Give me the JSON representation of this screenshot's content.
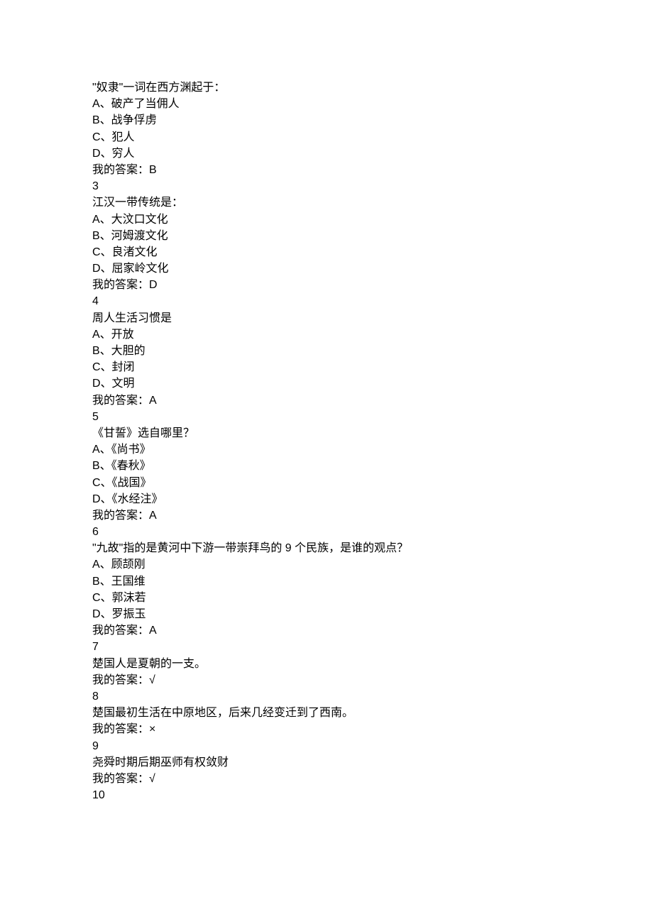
{
  "answer_prefix": "我的答案：",
  "tick": "√",
  "cross": "×",
  "items": [
    {
      "lines": [
        "\"奴隶\"一词在西方渊起于：",
        "A、破产了当佣人",
        "B、战争俘虏",
        "C、犯人",
        "D、穷人"
      ],
      "answer": "B"
    },
    {
      "number": "3",
      "lines": [
        "江汉一带传统是：",
        "A、大汶口文化",
        "B、河姆渡文化",
        "C、良渚文化",
        "D、屈家岭文化"
      ],
      "answer": "D"
    },
    {
      "number": "4",
      "lines": [
        "周人生活习惯是",
        "A、开放",
        "B、大胆的",
        "C、封闭",
        "D、文明"
      ],
      "answer": "A"
    },
    {
      "number": "5",
      "lines": [
        "《甘誓》选自哪里？",
        "A、《尚书》",
        "B、《春秋》",
        "C、《战国》",
        "D、《水经注》"
      ],
      "answer": "A"
    },
    {
      "number": "6",
      "lines": [
        "\"九故\"指的是黄河中下游一带崇拜鸟的 9 个民族，是谁的观点？",
        "A、顾颉刚",
        "B、王国维",
        "C、郭沫若",
        "D、罗振玉"
      ],
      "answer": "A"
    },
    {
      "number": "7",
      "lines": [
        "楚国人是夏朝的一支。"
      ],
      "answer": "√"
    },
    {
      "number": "8",
      "lines": [
        "楚国最初生活在中原地区，后来几经变迁到了西南。"
      ],
      "answer": "×"
    },
    {
      "number": "9",
      "lines": [
        "尧舜时期后期巫师有权敛财"
      ],
      "answer": "√"
    },
    {
      "number": "10"
    }
  ]
}
